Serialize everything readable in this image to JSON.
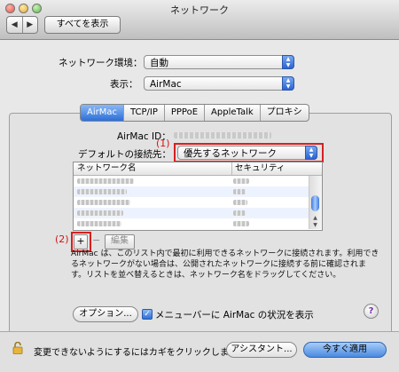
{
  "window": {
    "title": "ネットワーク"
  },
  "toolbar": {
    "back": "◀",
    "forward": "▶",
    "show_all": "すべてを表示"
  },
  "settings": {
    "location_label": "ネットワーク環境：",
    "location_value": "自動",
    "show_label": "表示：",
    "show_value": "AirMac"
  },
  "tabs": [
    {
      "label": "AirMac",
      "active": true
    },
    {
      "label": "TCP/IP",
      "active": false
    },
    {
      "label": "PPPoE",
      "active": false
    },
    {
      "label": "AppleTalk",
      "active": false
    },
    {
      "label": "プロキシ",
      "active": false
    }
  ],
  "airmac": {
    "id_label": "AirMac ID：",
    "default_join_label": "デフォルトの接続先：",
    "default_join_value": "優先するネットワーク",
    "annotation_1": "(1)",
    "annotation_2": "(2)"
  },
  "network_list": {
    "col_name": "ネットワーク名",
    "col_security": "セキュリティ"
  },
  "list_buttons": {
    "add": "+",
    "remove": "−",
    "edit": "編集"
  },
  "description": "AirMac は、このリスト内で最初に利用できるネットワークに接続されます。利用できるネットワークがない場合は、公開されたネットワークに接続する前に確認されます。リストを並べ替えるときは、ネットワーク名をドラッグしてください。",
  "options": {
    "options_button": "オプション...",
    "menubar_checkbox_label": "メニューバーに AirMac の状況を表示",
    "menubar_checked": true,
    "help": "?"
  },
  "footer": {
    "lock_text": "変更できないようにするにはカギをクリックします。",
    "assistant_button": "アシスタント...",
    "apply_button": "今すぐ適用"
  },
  "colors": {
    "annotation_red": "#d62020",
    "accent_blue": "#2d6fd8"
  }
}
